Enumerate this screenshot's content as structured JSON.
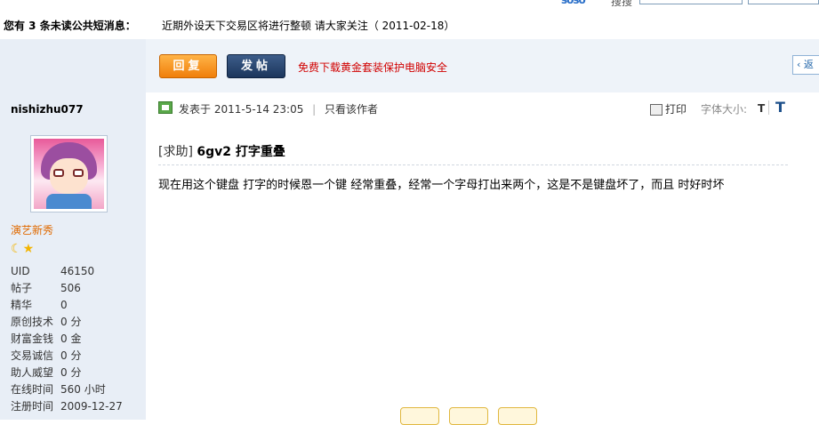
{
  "topbar": {
    "logo_text": "soso",
    "search_label": "搜搜"
  },
  "notice": {
    "label": "您有 3 条未读公共短消息：",
    "message": "近期外设天下交易区将进行整顿 请大家关注（ 2011-02-18）"
  },
  "toolbar": {
    "reply_label": "回复",
    "post_label": "发帖",
    "promo_text": "免费下载黄金套装保护电脑安全",
    "back_label": "返"
  },
  "user": {
    "name": "nishizhu077",
    "rank": "演艺新秀",
    "stats": [
      {
        "k": "UID",
        "v": "46150"
      },
      {
        "k": "帖子",
        "v": "506"
      },
      {
        "k": "精华",
        "v": "0"
      },
      {
        "k": "原创技术",
        "v": "0 分"
      },
      {
        "k": "财富金钱",
        "v": "0 金"
      },
      {
        "k": "交易诚信",
        "v": "0 分"
      },
      {
        "k": "助人威望",
        "v": "0 分"
      },
      {
        "k": "在线时间",
        "v": "560 小时"
      },
      {
        "k": "注册时间",
        "v": "2009-12-27"
      }
    ]
  },
  "post": {
    "posted_label": "发表于",
    "posted_time": "2011-5-14 23:05",
    "sep": "|",
    "author_only": "只看该作者",
    "print_label": "打印",
    "font_size_label": "字体大小:",
    "font_small": "T",
    "font_big": "T",
    "title_tag": "[求助]",
    "title": "6gv2 打字重叠",
    "body": "现在用这个键盘 打字的时候恩一个键 经常重叠，经常一个字母打出来两个，这是不是键盘坏了，而且 时好时坏"
  },
  "colors": {
    "sidebar_bg": "#e8eef6",
    "reply_button": "#f07f0a",
    "post_button": "#1c365c",
    "promo": "#d10000",
    "rank": "#e06a00"
  }
}
